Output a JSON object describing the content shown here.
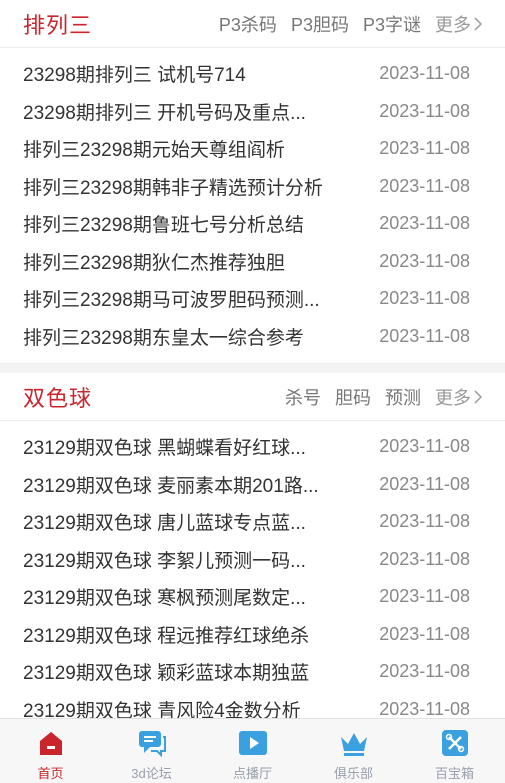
{
  "sections": [
    {
      "title": "排列三",
      "links": [
        "P3杀码",
        "P3胆码",
        "P3字谜"
      ],
      "more": "更多",
      "items": [
        {
          "title": "23298期排列三 试机号714",
          "date": "2023-11-08"
        },
        {
          "title": "23298期排列三 开机号码及重点...",
          "date": "2023-11-08"
        },
        {
          "title": "排列三23298期元始天尊组阎析",
          "date": "2023-11-08"
        },
        {
          "title": "排列三23298期韩非子精选预计分析",
          "date": "2023-11-08"
        },
        {
          "title": "排列三23298期鲁班七号分析总结",
          "date": "2023-11-08"
        },
        {
          "title": "排列三23298期狄仁杰推荐独胆",
          "date": "2023-11-08"
        },
        {
          "title": "排列三23298期马可波罗胆码预测...",
          "date": "2023-11-08"
        },
        {
          "title": "排列三23298期东皇太一综合参考",
          "date": "2023-11-08"
        }
      ]
    },
    {
      "title": "双色球",
      "links": [
        "杀号",
        "胆码",
        "预测"
      ],
      "more": "更多",
      "items": [
        {
          "title": "23129期双色球 黑蝴蝶看好红球...",
          "date": "2023-11-08"
        },
        {
          "title": "23129期双色球 麦丽素本期201路...",
          "date": "2023-11-08"
        },
        {
          "title": "23129期双色球 唐儿蓝球专点蓝...",
          "date": "2023-11-08"
        },
        {
          "title": "23129期双色球 李絮儿预测一码...",
          "date": "2023-11-08"
        },
        {
          "title": "23129期双色球 寒枫预测尾数定...",
          "date": "2023-11-08"
        },
        {
          "title": "23129期双色球 程远推荐红球绝杀",
          "date": "2023-11-08"
        },
        {
          "title": "23129期双色球 颖彩蓝球本期独蓝",
          "date": "2023-11-08"
        },
        {
          "title": "23129期双色球 青风险4金数分析",
          "date": "2023-11-08"
        }
      ]
    }
  ],
  "tabbar": [
    {
      "label": "首页",
      "icon": "home-icon",
      "active": true
    },
    {
      "label": "3d论坛",
      "icon": "chat-bubbles-icon",
      "active": false
    },
    {
      "label": "点播厅",
      "icon": "play-video-icon",
      "active": false
    },
    {
      "label": "俱乐部",
      "icon": "crown-icon",
      "active": false
    },
    {
      "label": "百宝箱",
      "icon": "toolbox-icon",
      "active": false
    }
  ],
  "colors": {
    "accent": "#c8252c",
    "tab_icon": "#3aa0e0",
    "tab_label": "#9a9fad"
  }
}
